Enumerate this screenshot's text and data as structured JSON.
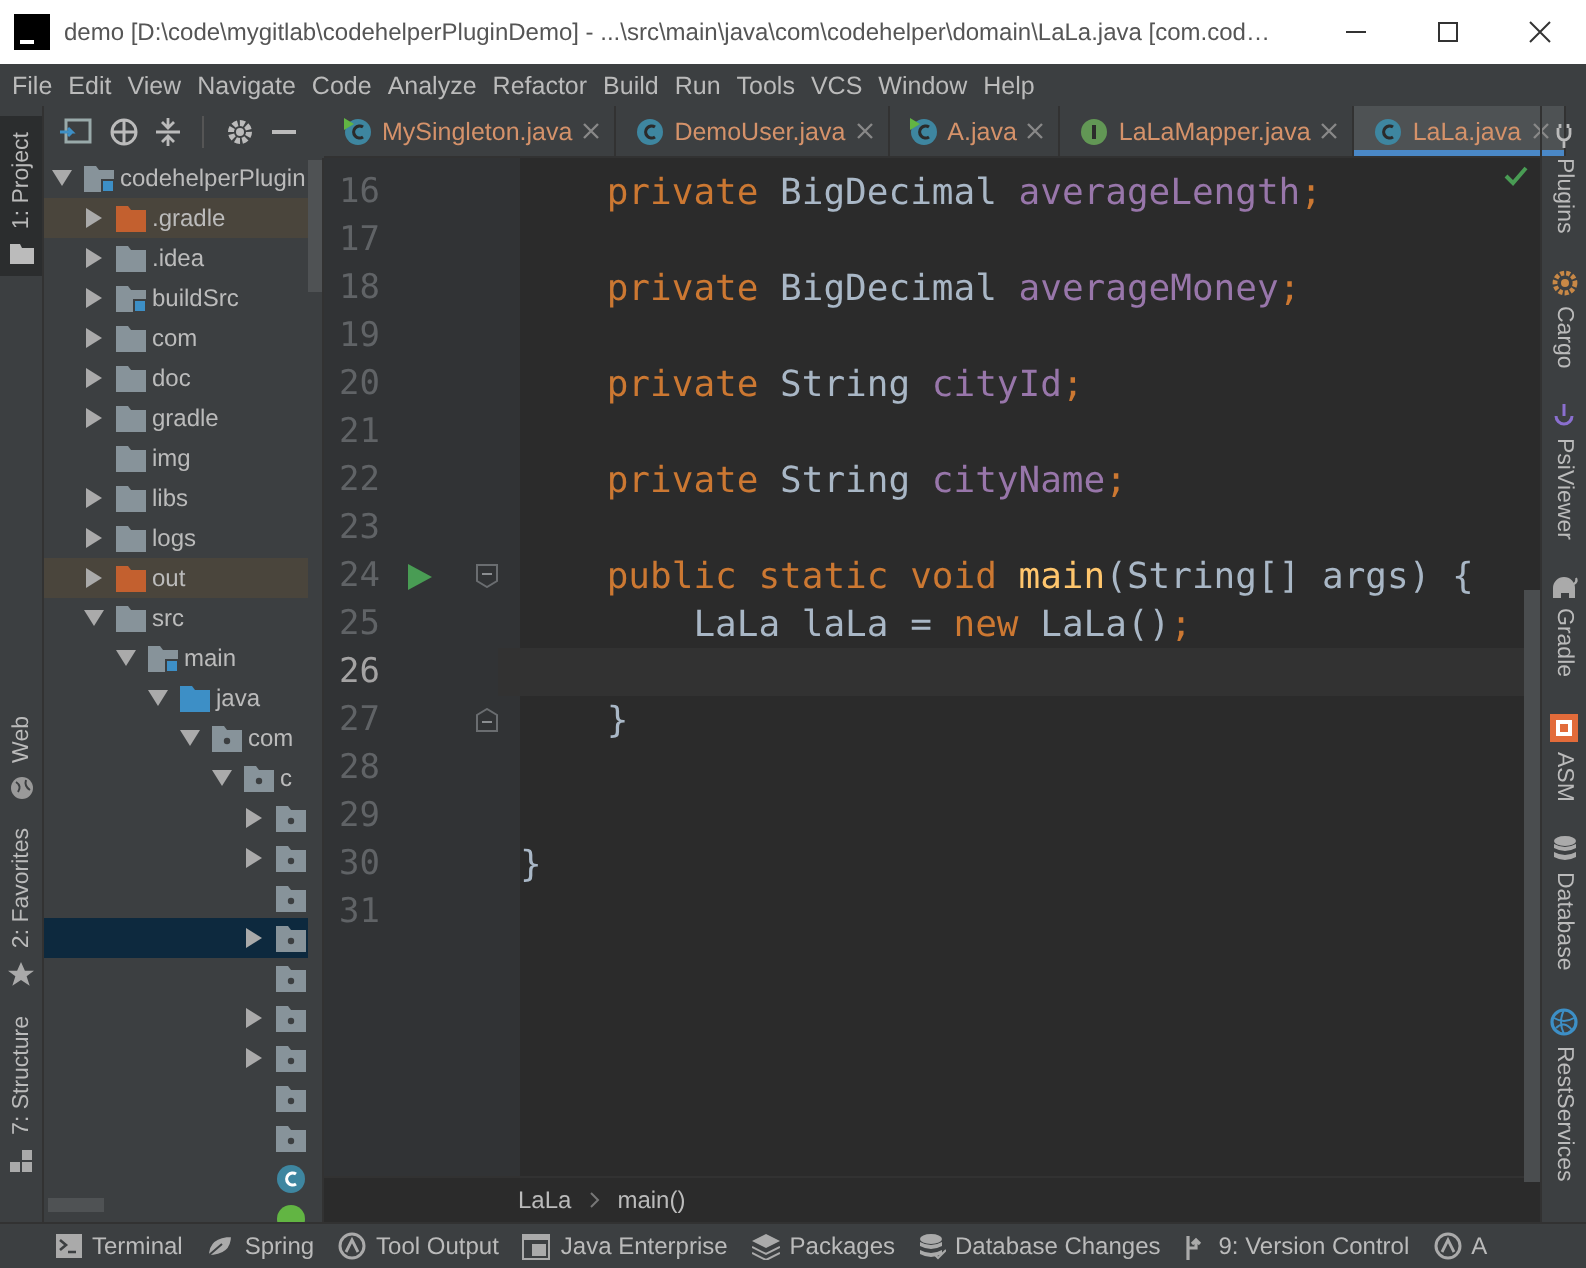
{
  "window": {
    "title": "demo [D:\\code\\mygitlab\\codehelperPluginDemo] - ...\\src\\main\\java\\com\\codehelper\\domain\\LaLa.java [com.cod…"
  },
  "menu": [
    "File",
    "Edit",
    "View",
    "Navigate",
    "Code",
    "Analyze",
    "Refactor",
    "Build",
    "Run",
    "Tools",
    "VCS",
    "Window",
    "Help"
  ],
  "left_tool_windows": [
    {
      "label": "1: Project",
      "selected": true,
      "kind": "project"
    },
    {
      "label": "Web",
      "selected": false,
      "kind": "web"
    },
    {
      "label": "2: Favorites",
      "selected": false,
      "kind": "favorites"
    },
    {
      "label": "7: Structure",
      "selected": false,
      "kind": "structure"
    }
  ],
  "project_tree": [
    {
      "label": "codehelperPlugin",
      "kind": "module",
      "expanded": true,
      "selected": false,
      "children": [
        {
          "label": ".gradle",
          "kind": "excluded",
          "expanded": false,
          "selected": false
        },
        {
          "label": ".idea",
          "kind": "folder",
          "expanded": false,
          "selected": false
        },
        {
          "label": "buildSrc",
          "kind": "module",
          "expanded": false,
          "selected": false
        },
        {
          "label": "com",
          "kind": "folder",
          "expanded": false,
          "selected": false
        },
        {
          "label": "doc",
          "kind": "folder",
          "expanded": false,
          "selected": false
        },
        {
          "label": "gradle",
          "kind": "folder",
          "expanded": false,
          "selected": false
        },
        {
          "label": "img",
          "kind": "folder",
          "selected": false
        },
        {
          "label": "libs",
          "kind": "folder",
          "expanded": false,
          "selected": false
        },
        {
          "label": "logs",
          "kind": "folder",
          "expanded": false,
          "selected": false
        },
        {
          "label": "out",
          "kind": "excluded",
          "expanded": false,
          "selected": false
        },
        {
          "label": "src",
          "kind": "folder",
          "expanded": true,
          "selected": false,
          "children": [
            {
              "label": "main",
              "kind": "module",
              "expanded": true,
              "selected": false,
              "children": [
                {
                  "label": "java",
                  "kind": "source",
                  "expanded": true,
                  "selected": false,
                  "children": [
                    {
                      "label": "com",
                      "kind": "package",
                      "expanded": true,
                      "selected": false,
                      "children": [
                        {
                          "label": "c",
                          "kind": "package",
                          "expanded": true,
                          "selected": false,
                          "children": [
                            {
                              "kind": "package",
                              "expanded": false,
                              "selected": false
                            },
                            {
                              "kind": "package",
                              "expanded": false,
                              "selected": false
                            },
                            {
                              "kind": "package",
                              "selected": false
                            },
                            {
                              "kind": "package",
                              "expanded": false,
                              "selected": true
                            },
                            {
                              "kind": "package",
                              "selected": false
                            },
                            {
                              "kind": "package",
                              "expanded": false,
                              "selected": false
                            },
                            {
                              "kind": "package",
                              "expanded": false,
                              "selected": false
                            },
                            {
                              "kind": "package",
                              "selected": false
                            },
                            {
                              "kind": "package",
                              "selected": false
                            },
                            {
                              "kind": "class",
                              "selected": false
                            },
                            {
                              "kind": "spring",
                              "selected": false
                            }
                          ]
                        }
                      ]
                    }
                  ]
                }
              ]
            }
          ]
        }
      ]
    }
  ],
  "editor_tabs": [
    {
      "label": "MySingleton.java",
      "kind": "runnable-class",
      "selected": false
    },
    {
      "label": "DemoUser.java",
      "kind": "class",
      "selected": false
    },
    {
      "label": "A.java",
      "kind": "runnable-class",
      "selected": false
    },
    {
      "label": "LaLaMapper.java",
      "kind": "interface",
      "selected": false
    },
    {
      "label": "LaLa.java",
      "kind": "class",
      "selected": true
    }
  ],
  "code_lines": [
    {
      "number": "16",
      "current": false,
      "run": false,
      "kind": "plain",
      "tokens": [
        {
          "kind": "keyword",
          "text": "    private "
        },
        {
          "kind": "plain",
          "text": "BigDecimal "
        },
        {
          "kind": "field",
          "text": "averageLength"
        },
        {
          "kind": "keyword",
          "text": ";"
        }
      ]
    },
    {
      "number": "17",
      "current": false,
      "run": false,
      "kind": "plain"
    },
    {
      "number": "18",
      "current": false,
      "run": false,
      "kind": "plain",
      "tokens": [
        {
          "kind": "keyword",
          "text": "    private "
        },
        {
          "kind": "plain",
          "text": "BigDecimal "
        },
        {
          "kind": "field",
          "text": "averageMoney"
        },
        {
          "kind": "keyword",
          "text": ";"
        }
      ]
    },
    {
      "number": "19",
      "current": false,
      "run": false,
      "kind": "plain"
    },
    {
      "number": "20",
      "current": false,
      "run": false,
      "kind": "plain",
      "tokens": [
        {
          "kind": "keyword",
          "text": "    private "
        },
        {
          "kind": "plain",
          "text": "String "
        },
        {
          "kind": "field",
          "text": "cityId"
        },
        {
          "kind": "keyword",
          "text": ";"
        }
      ]
    },
    {
      "number": "21",
      "current": false,
      "run": false,
      "kind": "plain"
    },
    {
      "number": "22",
      "current": false,
      "run": false,
      "kind": "plain",
      "tokens": [
        {
          "kind": "keyword",
          "text": "    private "
        },
        {
          "kind": "plain",
          "text": "String "
        },
        {
          "kind": "field",
          "text": "cityName"
        },
        {
          "kind": "keyword",
          "text": ";"
        }
      ]
    },
    {
      "number": "23",
      "current": false,
      "run": false,
      "kind": "plain"
    },
    {
      "number": "24",
      "current": false,
      "run": true,
      "kind": "fold-start",
      "tokens": [
        {
          "kind": "keyword",
          "text": "    public static void "
        },
        {
          "kind": "method",
          "text": "main"
        },
        {
          "kind": "plain",
          "text": "(String[] args) {"
        }
      ]
    },
    {
      "number": "25",
      "current": false,
      "run": false,
      "kind": "plain",
      "tokens": [
        {
          "kind": "plain",
          "text": "        LaLa laLa = "
        },
        {
          "kind": "keyword",
          "text": "new "
        },
        {
          "kind": "plain",
          "text": "LaLa()"
        },
        {
          "kind": "keyword",
          "text": ";"
        }
      ]
    },
    {
      "number": "26",
      "current": true,
      "run": false,
      "kind": "plain"
    },
    {
      "number": "27",
      "current": false,
      "run": false,
      "kind": "fold-end",
      "tokens": [
        {
          "kind": "plain",
          "text": "    }"
        }
      ]
    },
    {
      "number": "28",
      "current": false,
      "run": false,
      "kind": "plain"
    },
    {
      "number": "29",
      "current": false,
      "run": false,
      "kind": "plain"
    },
    {
      "number": "30",
      "current": false,
      "run": false,
      "kind": "plain",
      "tokens": [
        {
          "kind": "plain",
          "text": "}"
        }
      ]
    },
    {
      "number": "31",
      "current": false,
      "run": false,
      "kind": "plain"
    }
  ],
  "breadcrumbs": [
    "LaLa",
    "main()"
  ],
  "right_tool_windows": [
    {
      "label": "Plugins",
      "kind": "plugins"
    },
    {
      "label": "Cargo",
      "kind": "cargo"
    },
    {
      "label": "PsiViewer",
      "kind": "psi"
    },
    {
      "label": "Gradle",
      "kind": "gradle"
    },
    {
      "label": "ASM",
      "kind": "asm"
    },
    {
      "label": "Database",
      "kind": "database"
    },
    {
      "label": "RestServices",
      "kind": "rest"
    }
  ],
  "bottom_tool_windows": [
    {
      "label": "Terminal",
      "kind": "terminal"
    },
    {
      "label": "Spring",
      "kind": "spring"
    },
    {
      "label": "Tool Output",
      "kind": "output"
    },
    {
      "label": "Java Enterprise",
      "kind": "enterprise"
    },
    {
      "label": "Packages",
      "kind": "packages"
    },
    {
      "label": "Database Changes",
      "kind": "dbchanges"
    },
    {
      "label": "9: Version Control",
      "kind": "vcs"
    },
    {
      "label": "A",
      "kind": "output"
    }
  ]
}
